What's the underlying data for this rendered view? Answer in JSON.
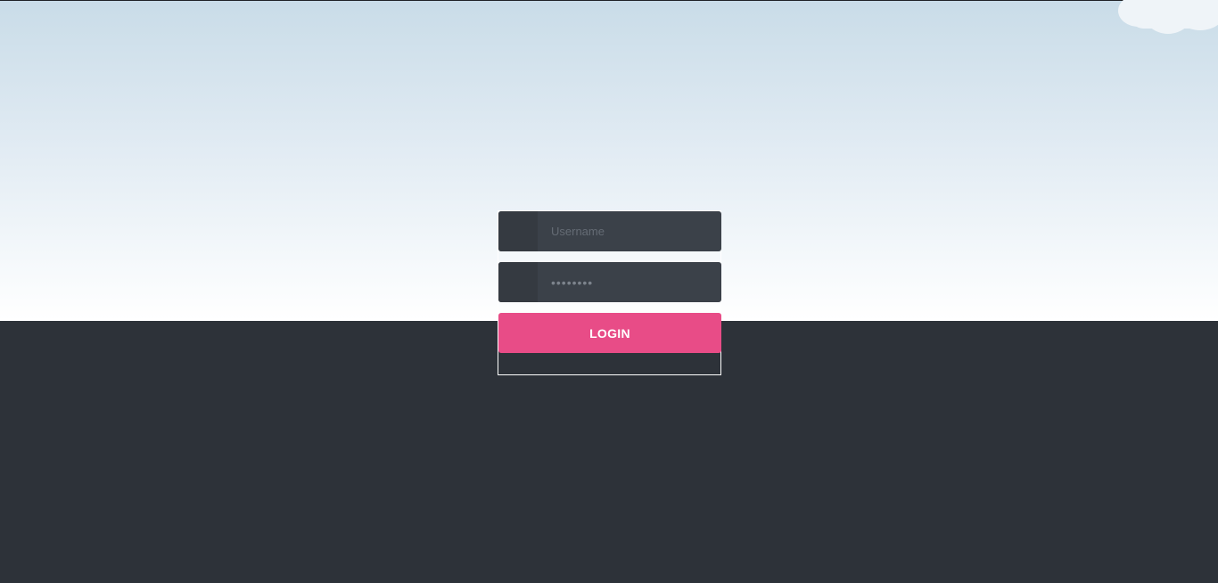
{
  "login_form": {
    "username": {
      "placeholder": "Username",
      "value": ""
    },
    "password": {
      "placeholder": "",
      "value": "••••••••"
    },
    "submit_label": "LOGIN"
  },
  "colors": {
    "sky_top": "#c9dce8",
    "sky_bottom": "#ffffff",
    "ground": "#2d3239",
    "field_background": "#3b4149",
    "button_accent": "#e84c87"
  }
}
